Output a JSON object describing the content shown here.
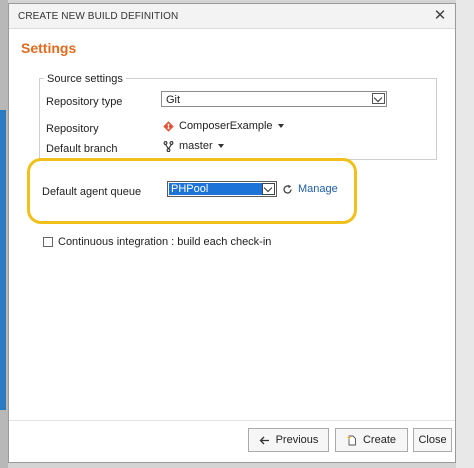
{
  "dialog": {
    "title": "CREATE NEW BUILD DEFINITION",
    "close_glyph": "✕"
  },
  "settings": {
    "heading": "Settings",
    "source_settings": {
      "legend": "Source settings",
      "repository_type_label": "Repository type",
      "repository_type_value": "Git",
      "repository_label": "Repository",
      "repository_value": "ComposerExample",
      "default_branch_label": "Default branch",
      "default_branch_value": "master"
    },
    "agent_queue": {
      "label": "Default agent queue",
      "value": "PHPool",
      "manage_label": "Manage"
    },
    "continuous_integration": {
      "label": "Continuous integration : build each check-in",
      "checked": false
    }
  },
  "footer": {
    "previous_label": "Previous",
    "create_label": "Create",
    "close_label": "Close"
  },
  "colors": {
    "heading": "#e06b1f",
    "highlight": "#f2c01a",
    "selection": "#1e73d8",
    "link": "#1f5ea8",
    "git_icon": "#e2533a"
  },
  "icons": {
    "repository": "git-diamond-icon",
    "branch": "branch-icon",
    "manage": "refresh-icon",
    "previous": "arrow-left-icon",
    "create": "new-document-icon"
  }
}
